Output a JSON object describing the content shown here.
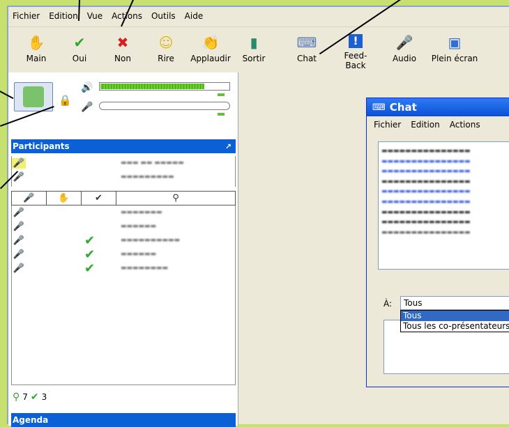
{
  "menu": [
    "Fichier",
    "Edition",
    "Vue",
    "Actions",
    "Outils",
    "Aide"
  ],
  "toolbar": [
    {
      "label": "Main",
      "icon": "hand-icon"
    },
    {
      "label": "Oui",
      "icon": "check-icon"
    },
    {
      "label": "Non",
      "icon": "cross-icon"
    },
    {
      "label": "Rire",
      "icon": "laugh-icon"
    },
    {
      "label": "Applaudir",
      "icon": "applause-icon"
    },
    {
      "label": "Sortir",
      "icon": "exit-door-icon"
    },
    {
      "label": "Chat",
      "icon": "chat-icon"
    },
    {
      "label": "Feed-Back",
      "icon": "feedback-icon"
    },
    {
      "label": "Audio",
      "icon": "audio-icon"
    },
    {
      "label": "Plein écran",
      "icon": "fullscreen-icon"
    }
  ],
  "audio": {
    "speaker_level": 0.8,
    "mic_level": 0.0
  },
  "participants_header": "Participants",
  "agenda_header": "Agenda",
  "columns": [
    "mic-icon",
    "hand-icon",
    "check-icon",
    "person-icon"
  ],
  "counts": {
    "participants": "7",
    "yes": "3"
  },
  "chat": {
    "title": "Chat",
    "menu": [
      "Fichier",
      "Edition",
      "Actions"
    ],
    "to_label": "À:",
    "to_value": "Tous",
    "to_options": [
      "Tous",
      "Tous les co-présentateurs"
    ]
  }
}
